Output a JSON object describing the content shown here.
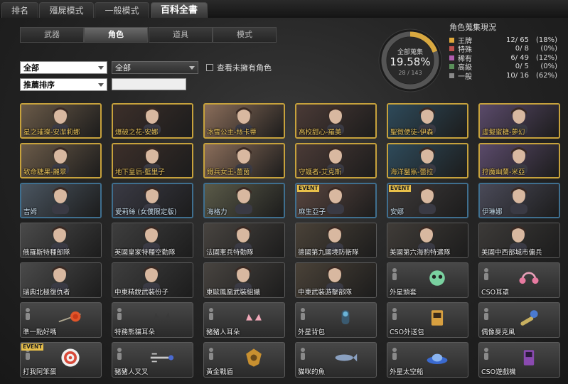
{
  "top_tabs": [
    "排名",
    "殭屍模式",
    "一般模式",
    "百科全書"
  ],
  "active_top_tab": "百科全書",
  "sub_tabs": [
    "武器",
    "角色",
    "道具",
    "模式"
  ],
  "active_sub_tab": "角色",
  "filters": {
    "combo1": "全部",
    "combo2": "全部",
    "sort": "推薦排序",
    "search_value": "",
    "checkbox_label": "查看未擁有角色"
  },
  "collection": {
    "label": "全部蒐集",
    "percent": "19.58%",
    "count": "28 / 143",
    "progress": 0.1958,
    "title": "角色蒐集現況",
    "rows": [
      {
        "name": "王牌",
        "value": "12/ 65",
        "pct": "(18%)",
        "color": "#e0a83a"
      },
      {
        "name": "特殊",
        "value": "0/  8",
        "pct": "(0%)",
        "color": "#c0504d"
      },
      {
        "name": "稀有",
        "value": "6/ 49",
        "pct": "(12%)",
        "color": "#b05db0"
      },
      {
        "name": "高級",
        "value": "0/  5",
        "pct": "(0%)",
        "color": "#5a8f5a"
      },
      {
        "name": "一般",
        "value": "10/ 16",
        "pct": "(62%)",
        "color": "#8a8a8a"
      }
    ]
  },
  "cards": [
    {
      "name": "星之璀璨-安潔莉娜",
      "tier": "gold",
      "event": ""
    },
    {
      "name": "爆破之花-安娜",
      "tier": "gold",
      "event": ""
    },
    {
      "name": "冰雪公主-絲卡蒂",
      "tier": "gold",
      "event": ""
    },
    {
      "name": "高校甜心-羅美",
      "tier": "gold",
      "event": ""
    },
    {
      "name": "聖徵使徒-伊森",
      "tier": "gold",
      "event": ""
    },
    {
      "name": "虛擬蜜糖-夢幻",
      "tier": "gold",
      "event": ""
    },
    {
      "name": "致命糖果-麗翠",
      "tier": "gold",
      "event": ""
    },
    {
      "name": "地下皇后-藍里子",
      "tier": "gold",
      "event": ""
    },
    {
      "name": "鐵兵女王-蕾茵",
      "tier": "gold",
      "event": ""
    },
    {
      "name": "守護者-艾克斯",
      "tier": "gold",
      "event": ""
    },
    {
      "name": "海洋鬣鯊-蕾拉",
      "tier": "gold",
      "event": ""
    },
    {
      "name": "狩魔幽蘭-米亞",
      "tier": "gold",
      "event": ""
    },
    {
      "name": "吉姆",
      "tier": "blue",
      "event": ""
    },
    {
      "name": "愛莉絲 (女僕限定版)",
      "tier": "blue",
      "event": ""
    },
    {
      "name": "海格力",
      "tier": "blue",
      "event": ""
    },
    {
      "name": "麻生亞子",
      "tier": "blue",
      "event": "EVENT"
    },
    {
      "name": "安娜",
      "tier": "blue",
      "event": "EVENT"
    },
    {
      "name": "伊琳娜",
      "tier": "blue",
      "event": ""
    },
    {
      "name": "俄羅斯特種部隊",
      "tier": "gray",
      "event": ""
    },
    {
      "name": "英國皇家特種空勤隊",
      "tier": "gray",
      "event": ""
    },
    {
      "name": "法國憲兵特勤隊",
      "tier": "gray",
      "event": ""
    },
    {
      "name": "德國第九國境防衛隊",
      "tier": "gray",
      "event": ""
    },
    {
      "name": "美國第六海豹特遣隊",
      "tier": "gray",
      "event": ""
    },
    {
      "name": "美國中西部城市傭兵",
      "tier": "gray",
      "event": ""
    },
    {
      "name": "瑞典北極復仇者",
      "tier": "gray",
      "event": ""
    },
    {
      "name": "中東精銳武裝份子",
      "tier": "gray",
      "event": ""
    },
    {
      "name": "東歐鳳凰武裝組織",
      "tier": "gray",
      "event": ""
    },
    {
      "name": "中東武裝游擊部隊",
      "tier": "gray",
      "event": ""
    },
    {
      "name": "外星頭套",
      "tier": "item",
      "event": ""
    },
    {
      "name": "CSO耳罩",
      "tier": "item",
      "event": ""
    },
    {
      "name": "準一點好嗎",
      "tier": "item",
      "event": ""
    },
    {
      "name": "特務熊貓耳朵",
      "tier": "item",
      "event": ""
    },
    {
      "name": "豬豬人耳朵",
      "tier": "item",
      "event": ""
    },
    {
      "name": "外星背包",
      "tier": "item",
      "event": ""
    },
    {
      "name": "CSO外送包",
      "tier": "item",
      "event": ""
    },
    {
      "name": "偶像麥克風",
      "tier": "item",
      "event": ""
    },
    {
      "name": "打我阿笨蛋",
      "tier": "item",
      "event": "EVENT"
    },
    {
      "name": "豬豬人叉叉",
      "tier": "item",
      "event": ""
    },
    {
      "name": "黃金戰盾",
      "tier": "item",
      "event": ""
    },
    {
      "name": "貓咪的魚",
      "tier": "item",
      "event": ""
    },
    {
      "name": "外星太空船",
      "tier": "item",
      "event": ""
    },
    {
      "name": "CSO遊戲機",
      "tier": "item",
      "event": ""
    }
  ]
}
